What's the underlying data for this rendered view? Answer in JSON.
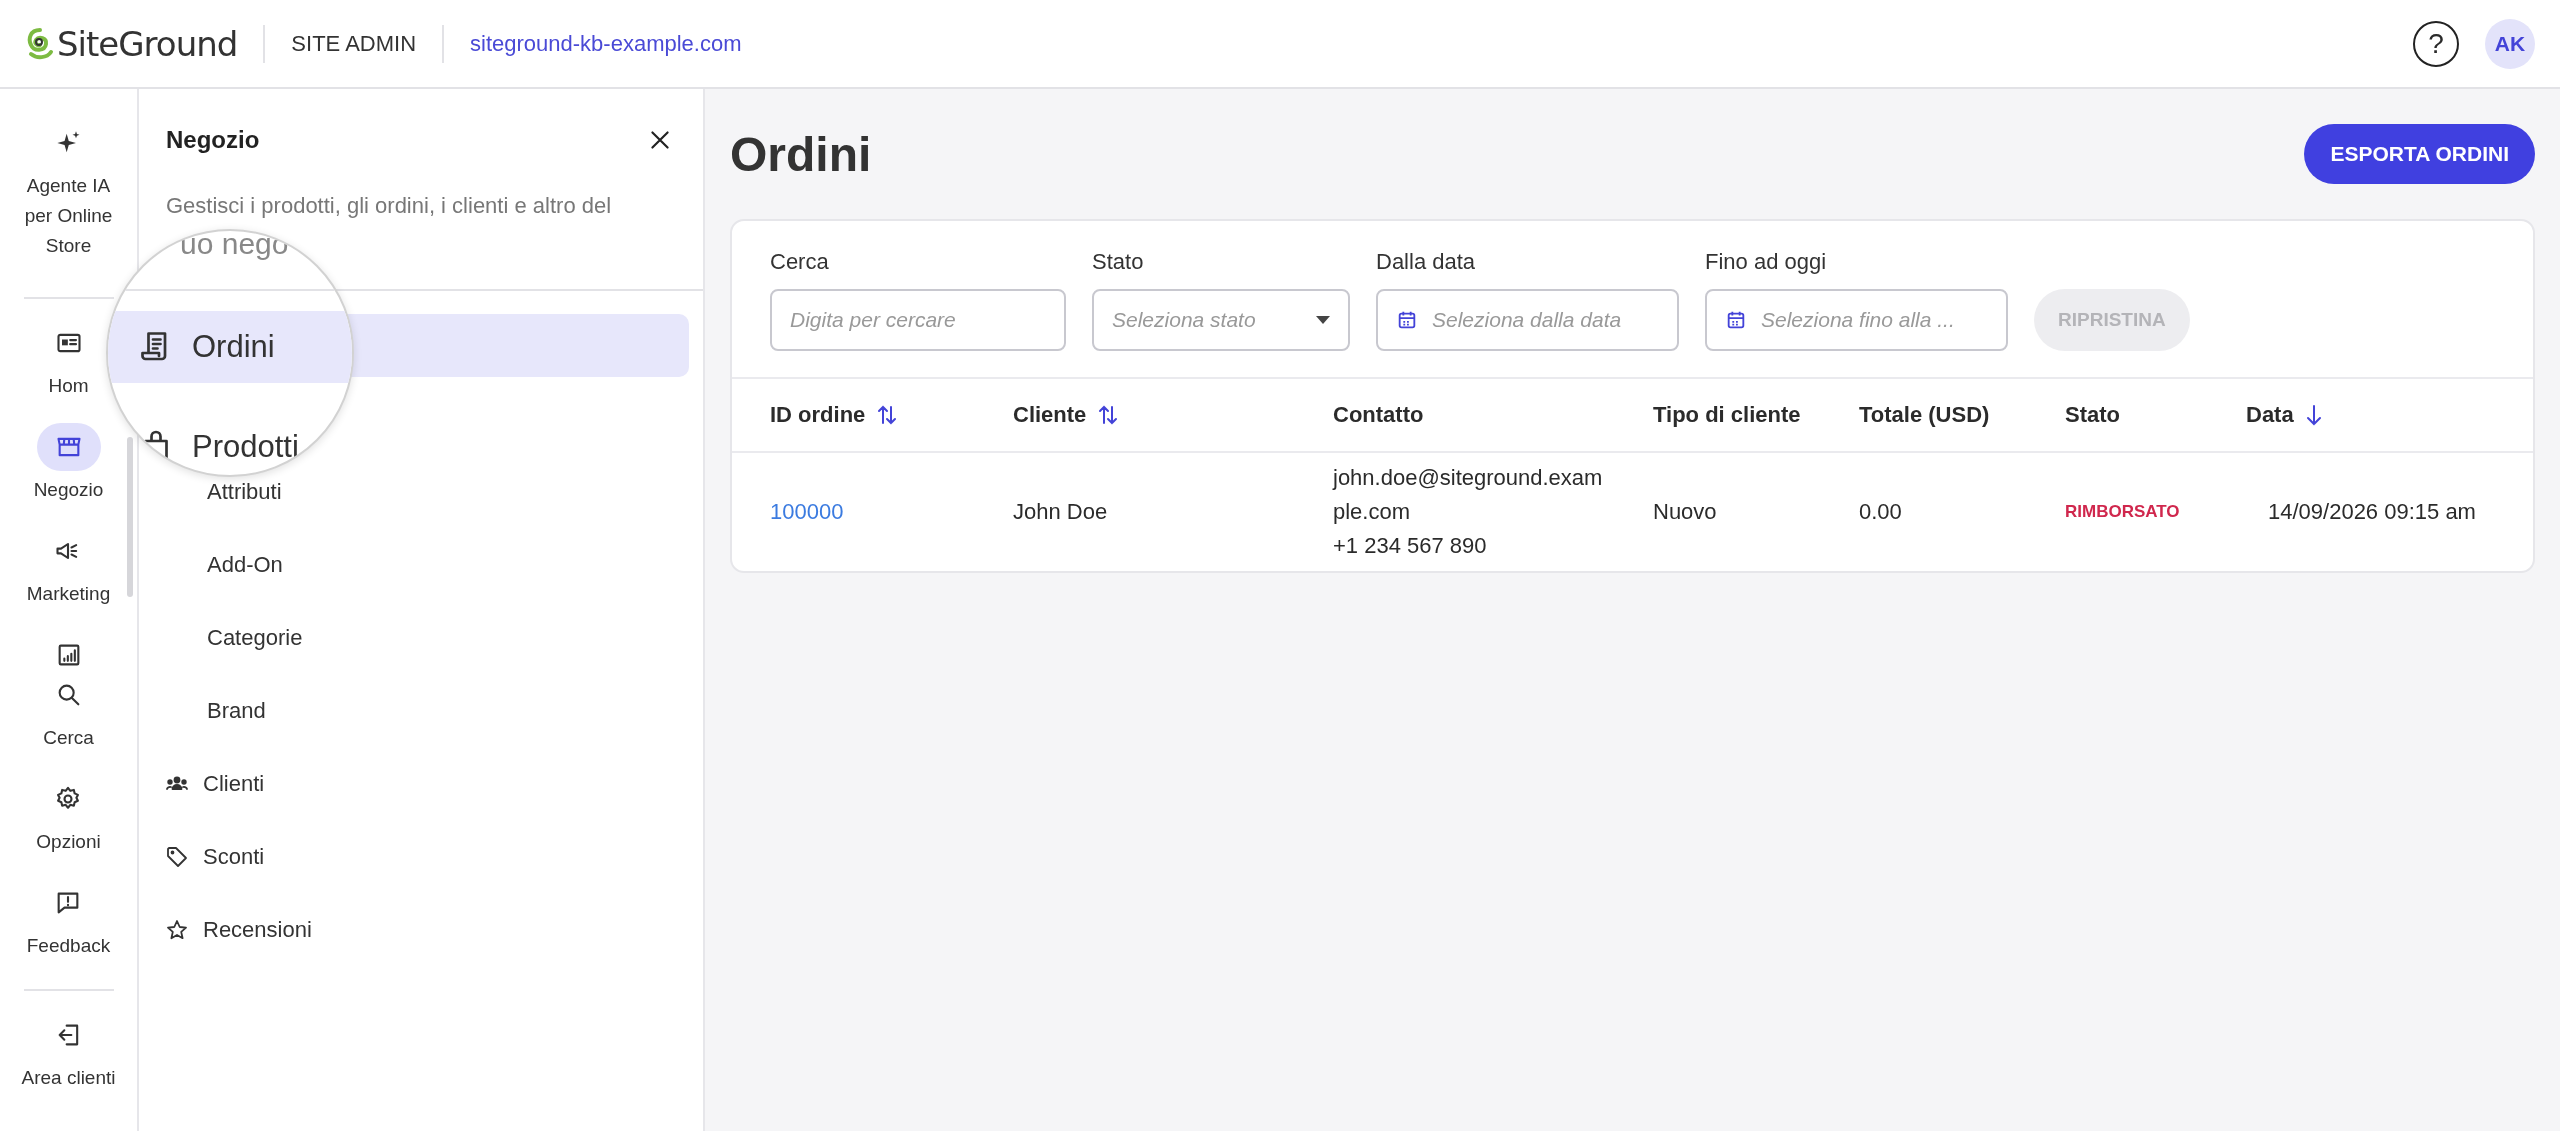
{
  "header": {
    "logo": "SiteGround",
    "section": "SITE ADMIN",
    "site": "siteground-kb-example.com",
    "help": "?",
    "avatar": "AK"
  },
  "rail": {
    "top": [
      {
        "label": "Agente IA per Online Store",
        "selected": false
      }
    ],
    "main": [
      {
        "label": "Hom",
        "selected": false
      },
      {
        "label": "Negozio",
        "selected": true
      },
      {
        "label": "Marketing",
        "selected": false
      },
      {
        "selected": false
      },
      {
        "label": "Cerca",
        "selected": false
      },
      {
        "label": "Opzioni",
        "selected": false
      },
      {
        "label": "Feedback",
        "selected": false
      }
    ],
    "bottom": [
      {
        "label": "Area clienti",
        "selected": false
      }
    ]
  },
  "panel": {
    "title": "Negozio",
    "description": "Gestisci i prodotti, gli ordini, i clienti e altro del",
    "magnifier_fragment": "uo nego",
    "items": [
      {
        "label": "Ordini",
        "selected": true,
        "magnified": true
      },
      {
        "label": "Prodotti",
        "selected": false,
        "magnified": true,
        "children": [
          {
            "label": "Attributi",
            "selected": false
          },
          {
            "label": "Add-On",
            "selected": false
          },
          {
            "label": "Categorie",
            "selected": false
          },
          {
            "label": "Brand",
            "selected": false
          }
        ]
      },
      {
        "label": "Clienti",
        "selected": false,
        "magnified": false
      },
      {
        "label": "Sconti",
        "selected": false,
        "magnified": false
      },
      {
        "label": "Recensioni",
        "selected": false,
        "magnified": false
      }
    ]
  },
  "page": {
    "title": "Ordini",
    "export_button": "ESPORTA ORDINI"
  },
  "filters": [
    {
      "label": "Cerca",
      "placeholder": "Digita per cercare",
      "kind": "text"
    },
    {
      "label": "Stato",
      "placeholder": "Seleziona stato",
      "kind": "select"
    },
    {
      "label": "Dalla data",
      "placeholder": "Seleziona dalla data",
      "kind": "date"
    },
    {
      "label": "Fino ad oggi",
      "placeholder": "Seleziona fino alla ...",
      "kind": "date"
    }
  ],
  "reset_button": {
    "label": "RIPRISTINA",
    "disabled": true
  },
  "table": {
    "columns": [
      {
        "label": "ID ordine",
        "kind": "sortable"
      },
      {
        "label": "Cliente",
        "kind": "sortable"
      },
      {
        "label": "Contatto",
        "kind": "plain"
      },
      {
        "label": "Tipo di cliente",
        "kind": "plain"
      },
      {
        "label": "Totale (USD)",
        "kind": "plain"
      },
      {
        "label": "Stato",
        "kind": "plain"
      },
      {
        "label": "Data",
        "kind": "sorted-desc"
      }
    ],
    "rows": [
      {
        "id": "100000",
        "customer": "John Doe",
        "contact": [
          "john.doe@siteground.example.com",
          "+1 234 567 890"
        ],
        "type": "Nuovo",
        "total": "0.00",
        "status": {
          "label": "RIMBORSATO",
          "color": "#d0274d"
        },
        "date": "14/09/2026 09:15 am"
      }
    ]
  }
}
